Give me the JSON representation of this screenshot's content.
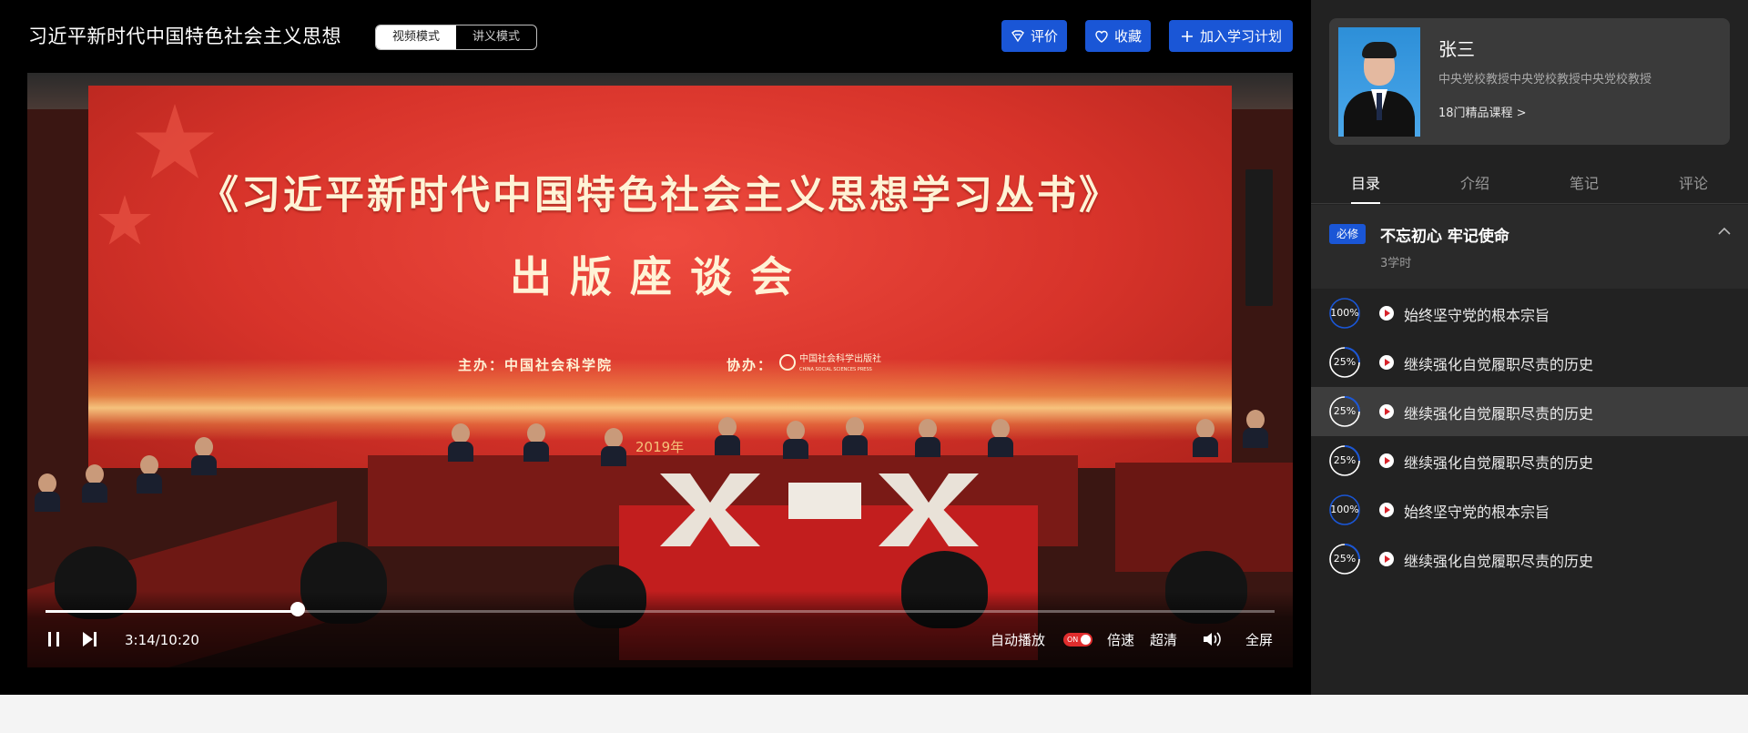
{
  "header": {
    "course_title": "习近平新时代中国特色社会主义思想",
    "modes": [
      {
        "label": "视频模式",
        "active": true
      },
      {
        "label": "讲义模式",
        "active": false
      }
    ],
    "rate_label": "评价",
    "favorite_label": "收藏",
    "add_plan_label": "加入学习计划"
  },
  "video": {
    "banner": {
      "title": "《习近平新时代中国特色社会主义思想学习丛书》",
      "subtitle": "出版座谈会",
      "host": "主办：中国社会科学院",
      "co_host": "协办：",
      "press_name": "中国社会科学出版社",
      "press_name_en": "CHINA SOCIAL SCIENCES PRESS",
      "year": "2019年"
    },
    "progress_fraction": 0.205,
    "current_time": "3:14",
    "duration": "10:20",
    "time_display": "3:14/10:20",
    "autoplay_label": "自动播放",
    "autoplay_on": true,
    "autoplay_switch_text": "ON",
    "speed_label": "倍速",
    "quality_label": "超清",
    "fullscreen_label": "全屏"
  },
  "teacher": {
    "name": "张三",
    "title": "中央党校教授中央党校教授中央党校教授",
    "courses_link": "18门精品课程 >"
  },
  "tabs": [
    {
      "label": "目录",
      "active": true
    },
    {
      "label": "介绍",
      "active": false
    },
    {
      "label": "笔记",
      "active": false
    },
    {
      "label": "评论",
      "active": false
    }
  ],
  "chapter": {
    "tag": "必修",
    "title": "不忘初心 牢记使命",
    "hours": "3学时",
    "expanded": true
  },
  "lessons": [
    {
      "progress": 100,
      "label": "100%",
      "title": "始终坚守党的根本宗旨",
      "active": false
    },
    {
      "progress": 25,
      "label": "25%",
      "title": "继续强化自觉履职尽责的历史",
      "active": false
    },
    {
      "progress": 25,
      "label": "25%",
      "title": "继续强化自觉履职尽责的历史",
      "active": true
    },
    {
      "progress": 25,
      "label": "25%",
      "title": "继续强化自觉履职尽责的历史",
      "active": false
    },
    {
      "progress": 100,
      "label": "100%",
      "title": "始终坚守党的根本宗旨",
      "active": false
    },
    {
      "progress": 25,
      "label": "25%",
      "title": "继续强化自觉履职尽责的历史",
      "active": false
    }
  ],
  "colors": {
    "accent": "#1a56d6",
    "ring_complete": "#1a56d6",
    "ring_partial": "#ffffff",
    "ring_track": "#5a5a5a",
    "autoplay_switch": "#e02d2d",
    "play_icon": "#d8222a"
  }
}
